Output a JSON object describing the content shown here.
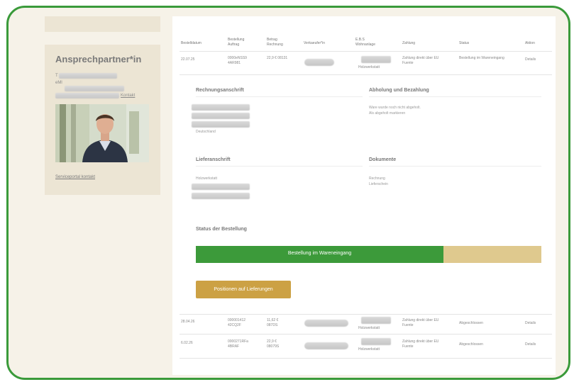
{
  "colors": {
    "border": "#3a9a3a",
    "progress_fill": "#3c9a3a",
    "progress_track": "#dfc98e",
    "button": "#cca144"
  },
  "sidebar": {
    "contact_title": "Ansprechpartner*in",
    "mini_lines": [
      "T",
      "eMl",
      "",
      "Kontakt"
    ],
    "support_link": "Serviceportal kontakt",
    "photo_icon": "person-photo"
  },
  "table": {
    "headers": [
      "Bestelldatum",
      "Bestellung Auftrag",
      "Betrag Rechnung",
      "Verkaeufer*in",
      "E.B.S Wohnanlage",
      "Zahlung",
      "Status",
      "Aktion"
    ],
    "rows": [
      {
        "date": "22.07.25",
        "order": "0000eNSS9 4AR981",
        "amount": "22,9 € 08131",
        "location": "Holzwerkstatt",
        "payment": "Zahlung direkt über EU Fuente",
        "status": "Bestellung im Wareneingang",
        "action": "Details"
      },
      {
        "date": "28.04.26",
        "order": "000001412 42CQ2F",
        "amount": "11,62 € 087DS",
        "location": "Holzwerkstatt",
        "payment": "Zahlung direkt über EU Fuente",
        "status": "Abgeschlossen",
        "action": "Details"
      },
      {
        "date": "6.02.26",
        "order": "0000271RFa 4BRAF",
        "amount": "22,9 € 08079S",
        "location": "Holzwerkstatt",
        "payment": "Zahlung direkt über EU Fuente",
        "status": "Abgeschlossen",
        "action": "Details"
      }
    ]
  },
  "details": {
    "billing_title": "Rechnungsanschrift",
    "billing_tail": "Deutschland",
    "pickup_title": "Abholung und Bezahlung",
    "pickup_text": [
      "Ware wurde noch nicht abgeholt.",
      "Als abgeholt markieren"
    ],
    "delivery_title": "Lieferanschrift",
    "delivery_text": "Holzwerkstatt",
    "documents_title": "Dokumente",
    "documents": [
      "Rechnung",
      "Lieferschein"
    ]
  },
  "status_section": {
    "title": "Status der Bestellung",
    "progress_label": "Bestellung im Wareneingang",
    "progress_fraction": 0.717
  },
  "cart_button": "Positionen auf Lieferungen"
}
